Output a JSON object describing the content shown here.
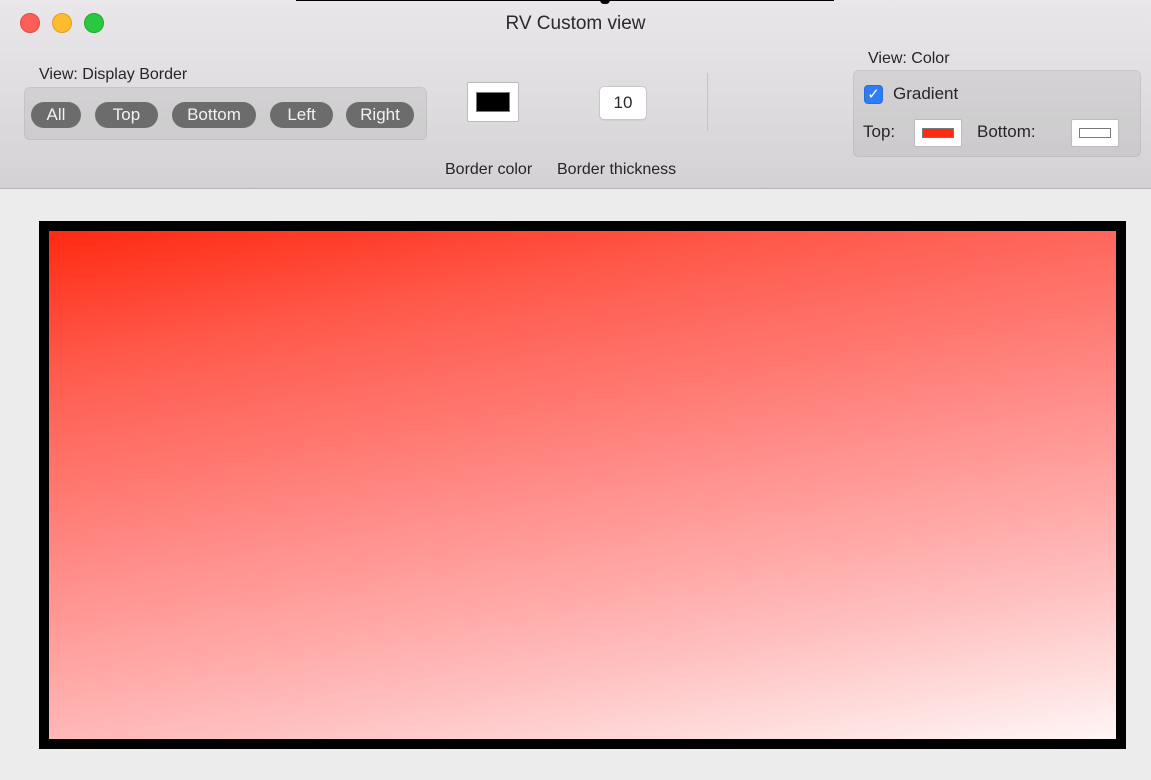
{
  "window": {
    "title": "RV Custom view"
  },
  "display_border": {
    "label": "View: Display Border",
    "buttons": [
      "All",
      "Top",
      "Bottom",
      "Left",
      "Right"
    ]
  },
  "border_color": {
    "label": "Border color",
    "value": "#000000"
  },
  "border_thickness": {
    "label": "Border thickness",
    "value": "10"
  },
  "view_color": {
    "label": "View: Color",
    "gradient_label": "Gradient",
    "gradient_checked": true,
    "top_label": "Top:",
    "top_color": "#ff2a12",
    "bottom_label": "Bottom:",
    "bottom_color": "#ffffff"
  },
  "canvas": {
    "border_color": "#000000",
    "gradient_top": "#ff2a12",
    "gradient_bottom": "#fff5f5"
  }
}
